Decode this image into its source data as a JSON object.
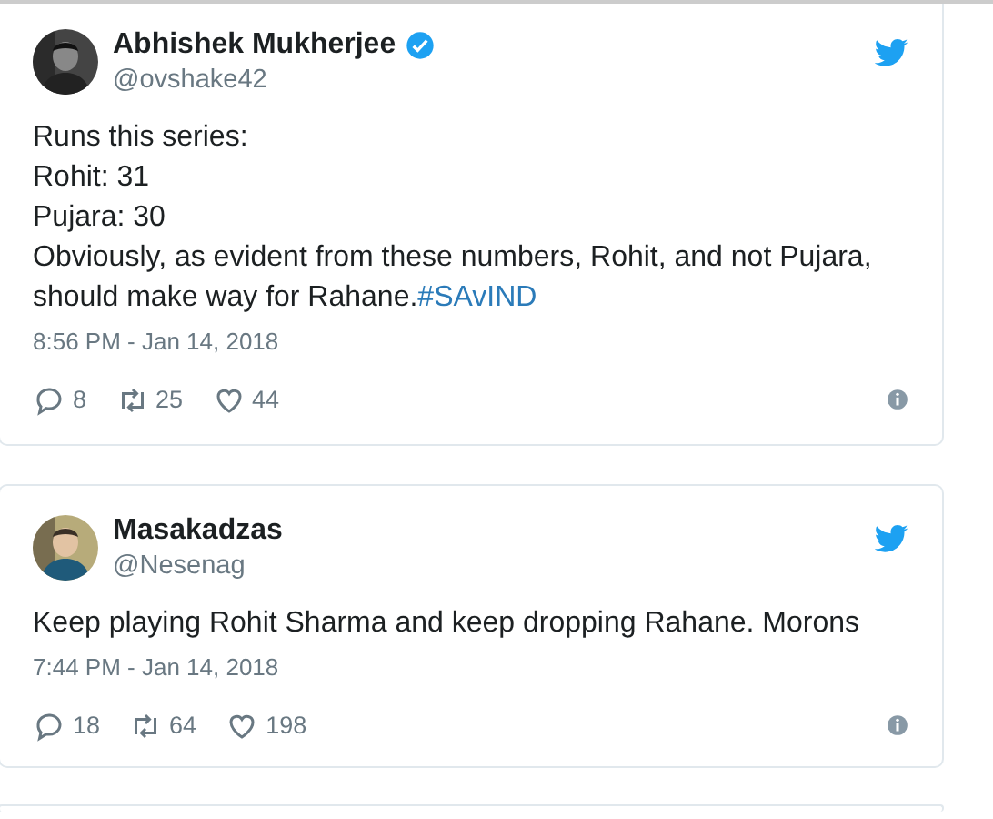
{
  "tweets": [
    {
      "name": "Abhishek Mukherjee",
      "verified": true,
      "handle": "@ovshake42",
      "lines": [
        "Runs this series:",
        "Rohit: 31",
        "Pujara: 30",
        "Obviously, as evident from these numbers, Rohit, and not Pujara, should make way for Rahane."
      ],
      "hashtag": "#SAvIND",
      "time": "8:56 PM - Jan 14, 2018",
      "replies": "8",
      "retweets": "25",
      "likes": "44"
    },
    {
      "name": "Masakadzas",
      "verified": false,
      "handle": "@Nesenag",
      "lines": [
        "Keep playing Rohit Sharma and keep dropping Rahane. Morons"
      ],
      "time": "7:44 PM - Jan 14, 2018",
      "replies": "18",
      "retweets": "64",
      "likes": "198"
    }
  ]
}
